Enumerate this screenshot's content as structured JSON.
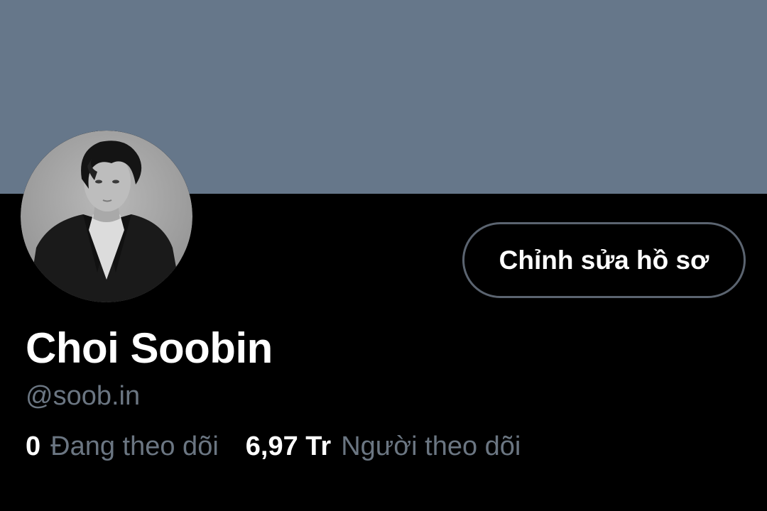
{
  "profile": {
    "display_name": "Choi Soobin",
    "handle": "@soob.in",
    "avatar_icon": "profile-photo",
    "banner_color": "#66778a"
  },
  "actions": {
    "edit_profile_label": "Chỉnh sửa hồ sơ"
  },
  "stats": {
    "following_count": "0",
    "following_label": "Đang theo dõi",
    "followers_count": "6,97 Tr",
    "followers_label": "Người theo dõi"
  },
  "colors": {
    "background": "#000000",
    "muted_text": "#6b7682",
    "button_border": "#5b6470"
  }
}
